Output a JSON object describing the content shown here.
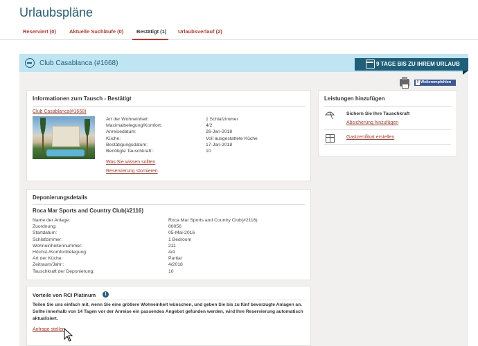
{
  "page": {
    "title": "Urlaubspläne"
  },
  "tabs": [
    {
      "label": "Reserviert (0)"
    },
    {
      "label": "Aktuelle Suchläufe (0)"
    },
    {
      "label": "Bestätigt (1)"
    },
    {
      "label": "Urlaubsverlauf (2)"
    }
  ],
  "club_bar": {
    "name": "Club Casablanca (#1668)",
    "days_badge": "9 TAGE BIS ZU IHREM URLAUB",
    "facebook_label": "Weiterempfehlen"
  },
  "exchange_card": {
    "title": "Informationen zum Tausch - Bestätigt",
    "club_link": "Club Casablanca(#1668)",
    "rows": [
      {
        "label": "Art der Wohneinheit:",
        "value": "1 Schlafzimmer"
      },
      {
        "label": "Maximalbelegung/Komfort:",
        "value": "4/2"
      },
      {
        "label": "Anreisedatum:",
        "value": "26-Jan-2018"
      },
      {
        "label": "Küche:",
        "value": "Voll ausgestattete Küche"
      },
      {
        "label": "Bestätigungsdatum:",
        "value": "17-Jan-2018"
      },
      {
        "label": "Benötigte Tauschkraft::",
        "value": "10"
      }
    ],
    "link_info": "Was Sie wissen sollten",
    "link_cancel": "Reservierung stornieren"
  },
  "services_card": {
    "title": "Leistungen hinzufügen",
    "item1_title": "Sichern Sie Ihre Tauschkraft",
    "item1_link": "Absicherung hinzufügen",
    "item2_link": "Gastzertifikat erstellen"
  },
  "deposit_card": {
    "title": "Deponierungsdetails",
    "resort": "Roca Mar Sports and Country Club(#2116)",
    "rows": [
      {
        "label": "Name der Anlage:",
        "value": "Roca Mar Sports and Country Club(#2116)"
      },
      {
        "label": "Zuordnung:",
        "value": "00056"
      },
      {
        "label": "Startdatum:",
        "value": "05-Mai-2016"
      },
      {
        "label": "Schlafzimmer:",
        "value": "1 Bedroom"
      },
      {
        "label": "Wohneinheitennummer:",
        "value": "211"
      },
      {
        "label": "Höchst-/Komfortbelegung:",
        "value": "4/4"
      },
      {
        "label": "Art der Küche:",
        "value": "Partial"
      },
      {
        "label": "Zeitraum/Jahr::",
        "value": "4/2018"
      },
      {
        "label": "Tauschkraft der Deponierung:",
        "value": "10"
      }
    ]
  },
  "platinum_card": {
    "title": "Vorteile von RCI Platinum",
    "text": "Teilen Sie uns einfach mit, wenn Sie eine größere Wohneinheit wünschen, und geben Sie bis zu fünf bevorzugte Anlagen an. Sollte innerhalb von 14 Tagen vor der Anreise ein passendes Angebot gefunden werden, wird Ihre Reservierung automatisch aktualisiert.",
    "link": "Anfrage stellen"
  }
}
